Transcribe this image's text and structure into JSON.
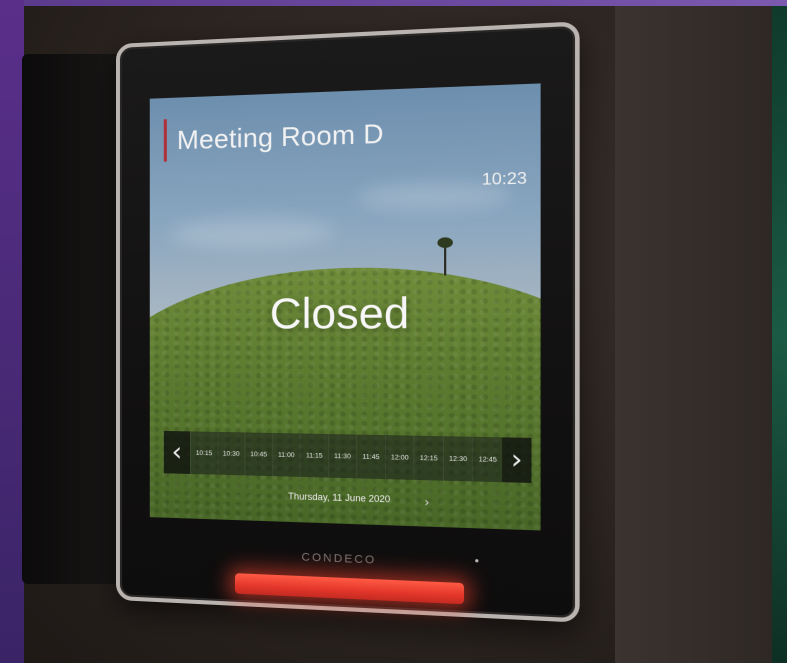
{
  "room": {
    "name": "Meeting Room D"
  },
  "clock": {
    "time": "10:23"
  },
  "status": {
    "label": "Closed"
  },
  "timeline": {
    "prev_arrow": "‹",
    "next_arrow": "›",
    "slots": [
      "10:15",
      "10:30",
      "10:45",
      "11:00",
      "11:15",
      "11:30",
      "11:45",
      "12:00",
      "12:15",
      "12:30",
      "12:45"
    ]
  },
  "date": {
    "label": "Thursday, 11 June 2020",
    "next_arrow": "›"
  },
  "brand": {
    "name": "CONDECO"
  },
  "colors": {
    "accent": "#b0303a",
    "led": "#e3362a"
  }
}
